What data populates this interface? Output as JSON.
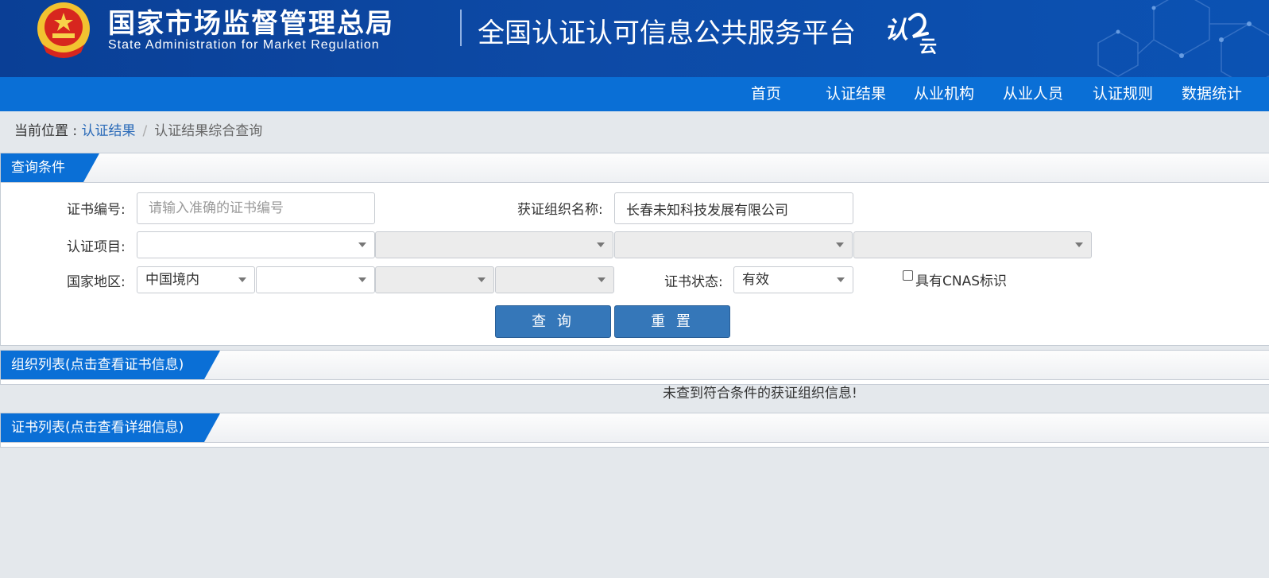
{
  "header": {
    "org_name_cn": "国家市场监督管理总局",
    "org_name_en": "State Administration  for  Market Regulation",
    "platform_title": "全国认证认可信息公共服务平台",
    "logo_text": "认证云"
  },
  "nav": {
    "items": [
      "首页",
      "认证结果",
      "从业机构",
      "从业人员",
      "认证规则",
      "数据统计"
    ]
  },
  "breadcrumb": {
    "prefix": "当前位置 : ",
    "link": "认证结果",
    "separator": "/",
    "current": "认证结果综合查询"
  },
  "query_panel": {
    "title": "查询条件",
    "cert_no_label": "证书编号:",
    "cert_no_placeholder": "请输入准确的证书编号",
    "cert_no_value": "",
    "org_name_label": "获证组织名称:",
    "org_name_value": "长春未知科技发展有限公司",
    "project_label": "认证项目:",
    "project_selects": [
      "",
      "",
      "",
      ""
    ],
    "region_label": "国家地区:",
    "region_selects": [
      "中国境内",
      "",
      "",
      ""
    ],
    "status_label": "证书状态:",
    "status_value": "有效",
    "cnas_label": "具有CNAS标识",
    "cnas_checked": false,
    "search_button": "查 询",
    "reset_button": "重 置"
  },
  "org_list_panel": {
    "title": "组织列表(点击查看证书信息)",
    "empty_message": "未查到符合条件的获证组织信息!"
  },
  "cert_list_panel": {
    "title": "证书列表(点击查看详细信息)"
  },
  "colors": {
    "header_bg": "#0d4aa6",
    "nav_bg": "#0a6fd6",
    "tab_bg": "#0a6fd6",
    "button_bg": "#3577b9",
    "page_bg": "#e4e8ec"
  }
}
